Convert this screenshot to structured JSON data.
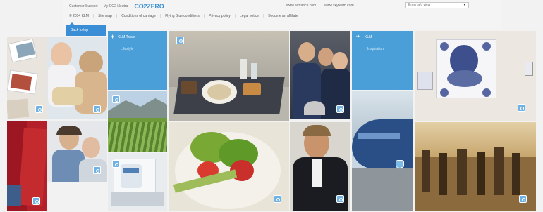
{
  "header": {
    "customer_support": "Customer Support",
    "my_co2": "My CO2 Neutral",
    "logo": "CO2ZERO",
    "link_a": "www.airfrance.com",
    "link_b": "www.skyteam.com",
    "select_value": "Enter a/c view",
    "nav": [
      "© 2014 KLM",
      "Site map",
      "Conditions of carriage",
      "Flying Blue conditions",
      "Privacy policy",
      "Legal notice",
      "Become an affiliate"
    ]
  },
  "back_to_top": "Back to top",
  "tiles": {
    "blue1": {
      "title": "KLM Travel",
      "sub": "Lifestyle"
    },
    "blue2": {
      "title": "KLM",
      "sub": "Inspiration"
    }
  },
  "icons": {
    "plus": "+",
    "plane": "✈",
    "chevron": "▾"
  },
  "colors": {
    "accent": "#3a8ed6",
    "tile_blue": "#4a9fd8"
  }
}
